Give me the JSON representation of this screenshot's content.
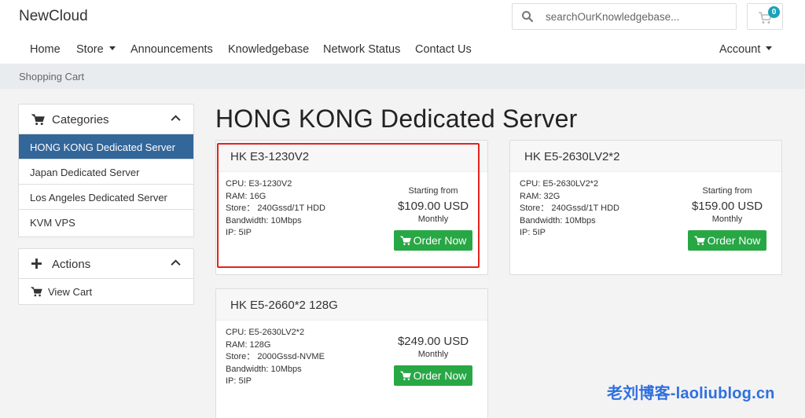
{
  "brand": "NewCloud",
  "search": {
    "placeholder": "searchOurKnowledgebase..."
  },
  "cart": {
    "count": "0"
  },
  "nav": {
    "home": "Home",
    "store": "Store",
    "announcements": "Announcements",
    "knowledgebase": "Knowledgebase",
    "network_status": "Network Status",
    "contact_us": "Contact Us",
    "account": "Account"
  },
  "breadcrumb": "Shopping Cart",
  "sidebar": {
    "categories_title": "Categories",
    "categories": [
      {
        "label": "HONG KONG Dedicated Server",
        "active": true
      },
      {
        "label": "Japan Dedicated Server"
      },
      {
        "label": "Los Angeles Dedicated Server"
      },
      {
        "label": "KVM VPS"
      }
    ],
    "actions_title": "Actions",
    "actions": [
      {
        "label": "View Cart"
      }
    ]
  },
  "page_title": "HONG KONG Dedicated Server",
  "products": [
    {
      "name": "HK E3-1230V2",
      "specs": [
        "CPU:  E3-1230V2",
        "RAM:  16G",
        "Store： 240Gssd/1T HDD",
        "Bandwidth:  10Mbps",
        "IP:  5IP"
      ],
      "starting_from": "Starting from",
      "price": "$109.00 USD",
      "cycle": "Monthly",
      "order_label": "Order Now"
    },
    {
      "name": "HK E5-2630LV2*2",
      "specs": [
        "CPU:  E5-2630LV2*2",
        "RAM:  32G",
        "Store： 240Gssd/1T HDD",
        "Bandwidth:  10Mbps",
        "IP:  5IP"
      ],
      "starting_from": "Starting from",
      "price": "$159.00 USD",
      "cycle": "Monthly",
      "order_label": "Order Now"
    },
    {
      "name": "HK E5-2660*2 128G",
      "specs": [
        "CPU:  E5-2630LV2*2",
        "RAM:  128G",
        "Store： 2000Gssd-NVME",
        "Bandwidth:  10Mbps",
        "IP:  5IP"
      ],
      "price": "$249.00 USD",
      "cycle": "Monthly",
      "order_label": "Order Now"
    }
  ],
  "watermark": "老刘博客-laoliublog.cn",
  "colors": {
    "active_category": "#336699",
    "order_button": "#28a745",
    "badge": "#17a2b8",
    "highlight_box": "#e5231f",
    "watermark": "#2f6fe0"
  },
  "icons": [
    "search-icon",
    "cart-icon",
    "chevron-up-icon",
    "plus-icon",
    "caret-down-icon"
  ]
}
